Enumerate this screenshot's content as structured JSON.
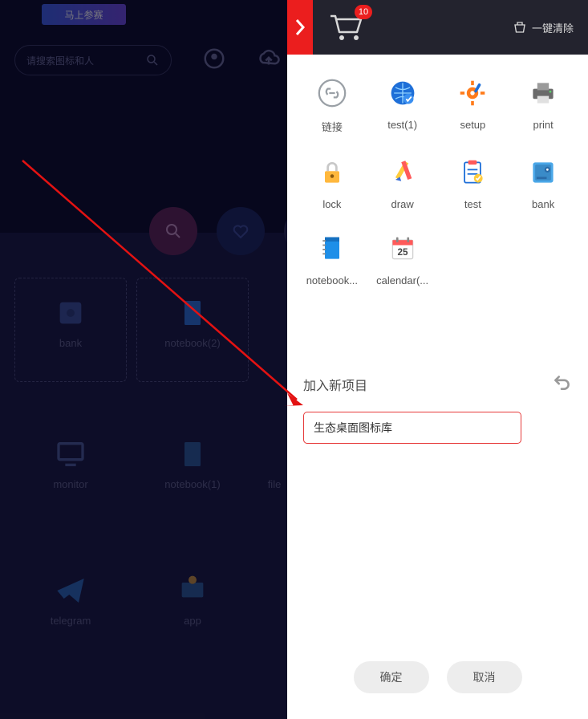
{
  "bg": {
    "banner_label": "马上参赛",
    "search_placeholder": "请搜索图标和人",
    "items": {
      "bank": "bank",
      "notebook2": "notebook(2)",
      "monitor": "monitor",
      "notebook1": "notebook(1)",
      "file": "file",
      "telegram": "telegram",
      "app": "app"
    }
  },
  "header": {
    "cart_count": "10",
    "clear_label": "一键清除"
  },
  "grid": [
    {
      "id": "link-item",
      "label": "链接",
      "icon": "link"
    },
    {
      "id": "test1-item",
      "label": "test(1)",
      "icon": "globe"
    },
    {
      "id": "setup-item",
      "label": "setup",
      "icon": "gear"
    },
    {
      "id": "print-item",
      "label": "print",
      "icon": "printer"
    },
    {
      "id": "lock-item",
      "label": "lock",
      "icon": "lock"
    },
    {
      "id": "draw-item",
      "label": "draw",
      "icon": "pencil"
    },
    {
      "id": "test-item",
      "label": "test",
      "icon": "clipboard"
    },
    {
      "id": "bank-item",
      "label": "bank",
      "icon": "safe"
    },
    {
      "id": "notebook-item",
      "label": "notebook...",
      "icon": "notebook"
    },
    {
      "id": "calendar-item",
      "label": "calendar(...",
      "icon": "calendar"
    }
  ],
  "calendar_day": "25",
  "add_section": {
    "title": "加入新项目",
    "input_value": "生态桌面图标库"
  },
  "actions": {
    "confirm": "确定",
    "cancel": "取消"
  }
}
